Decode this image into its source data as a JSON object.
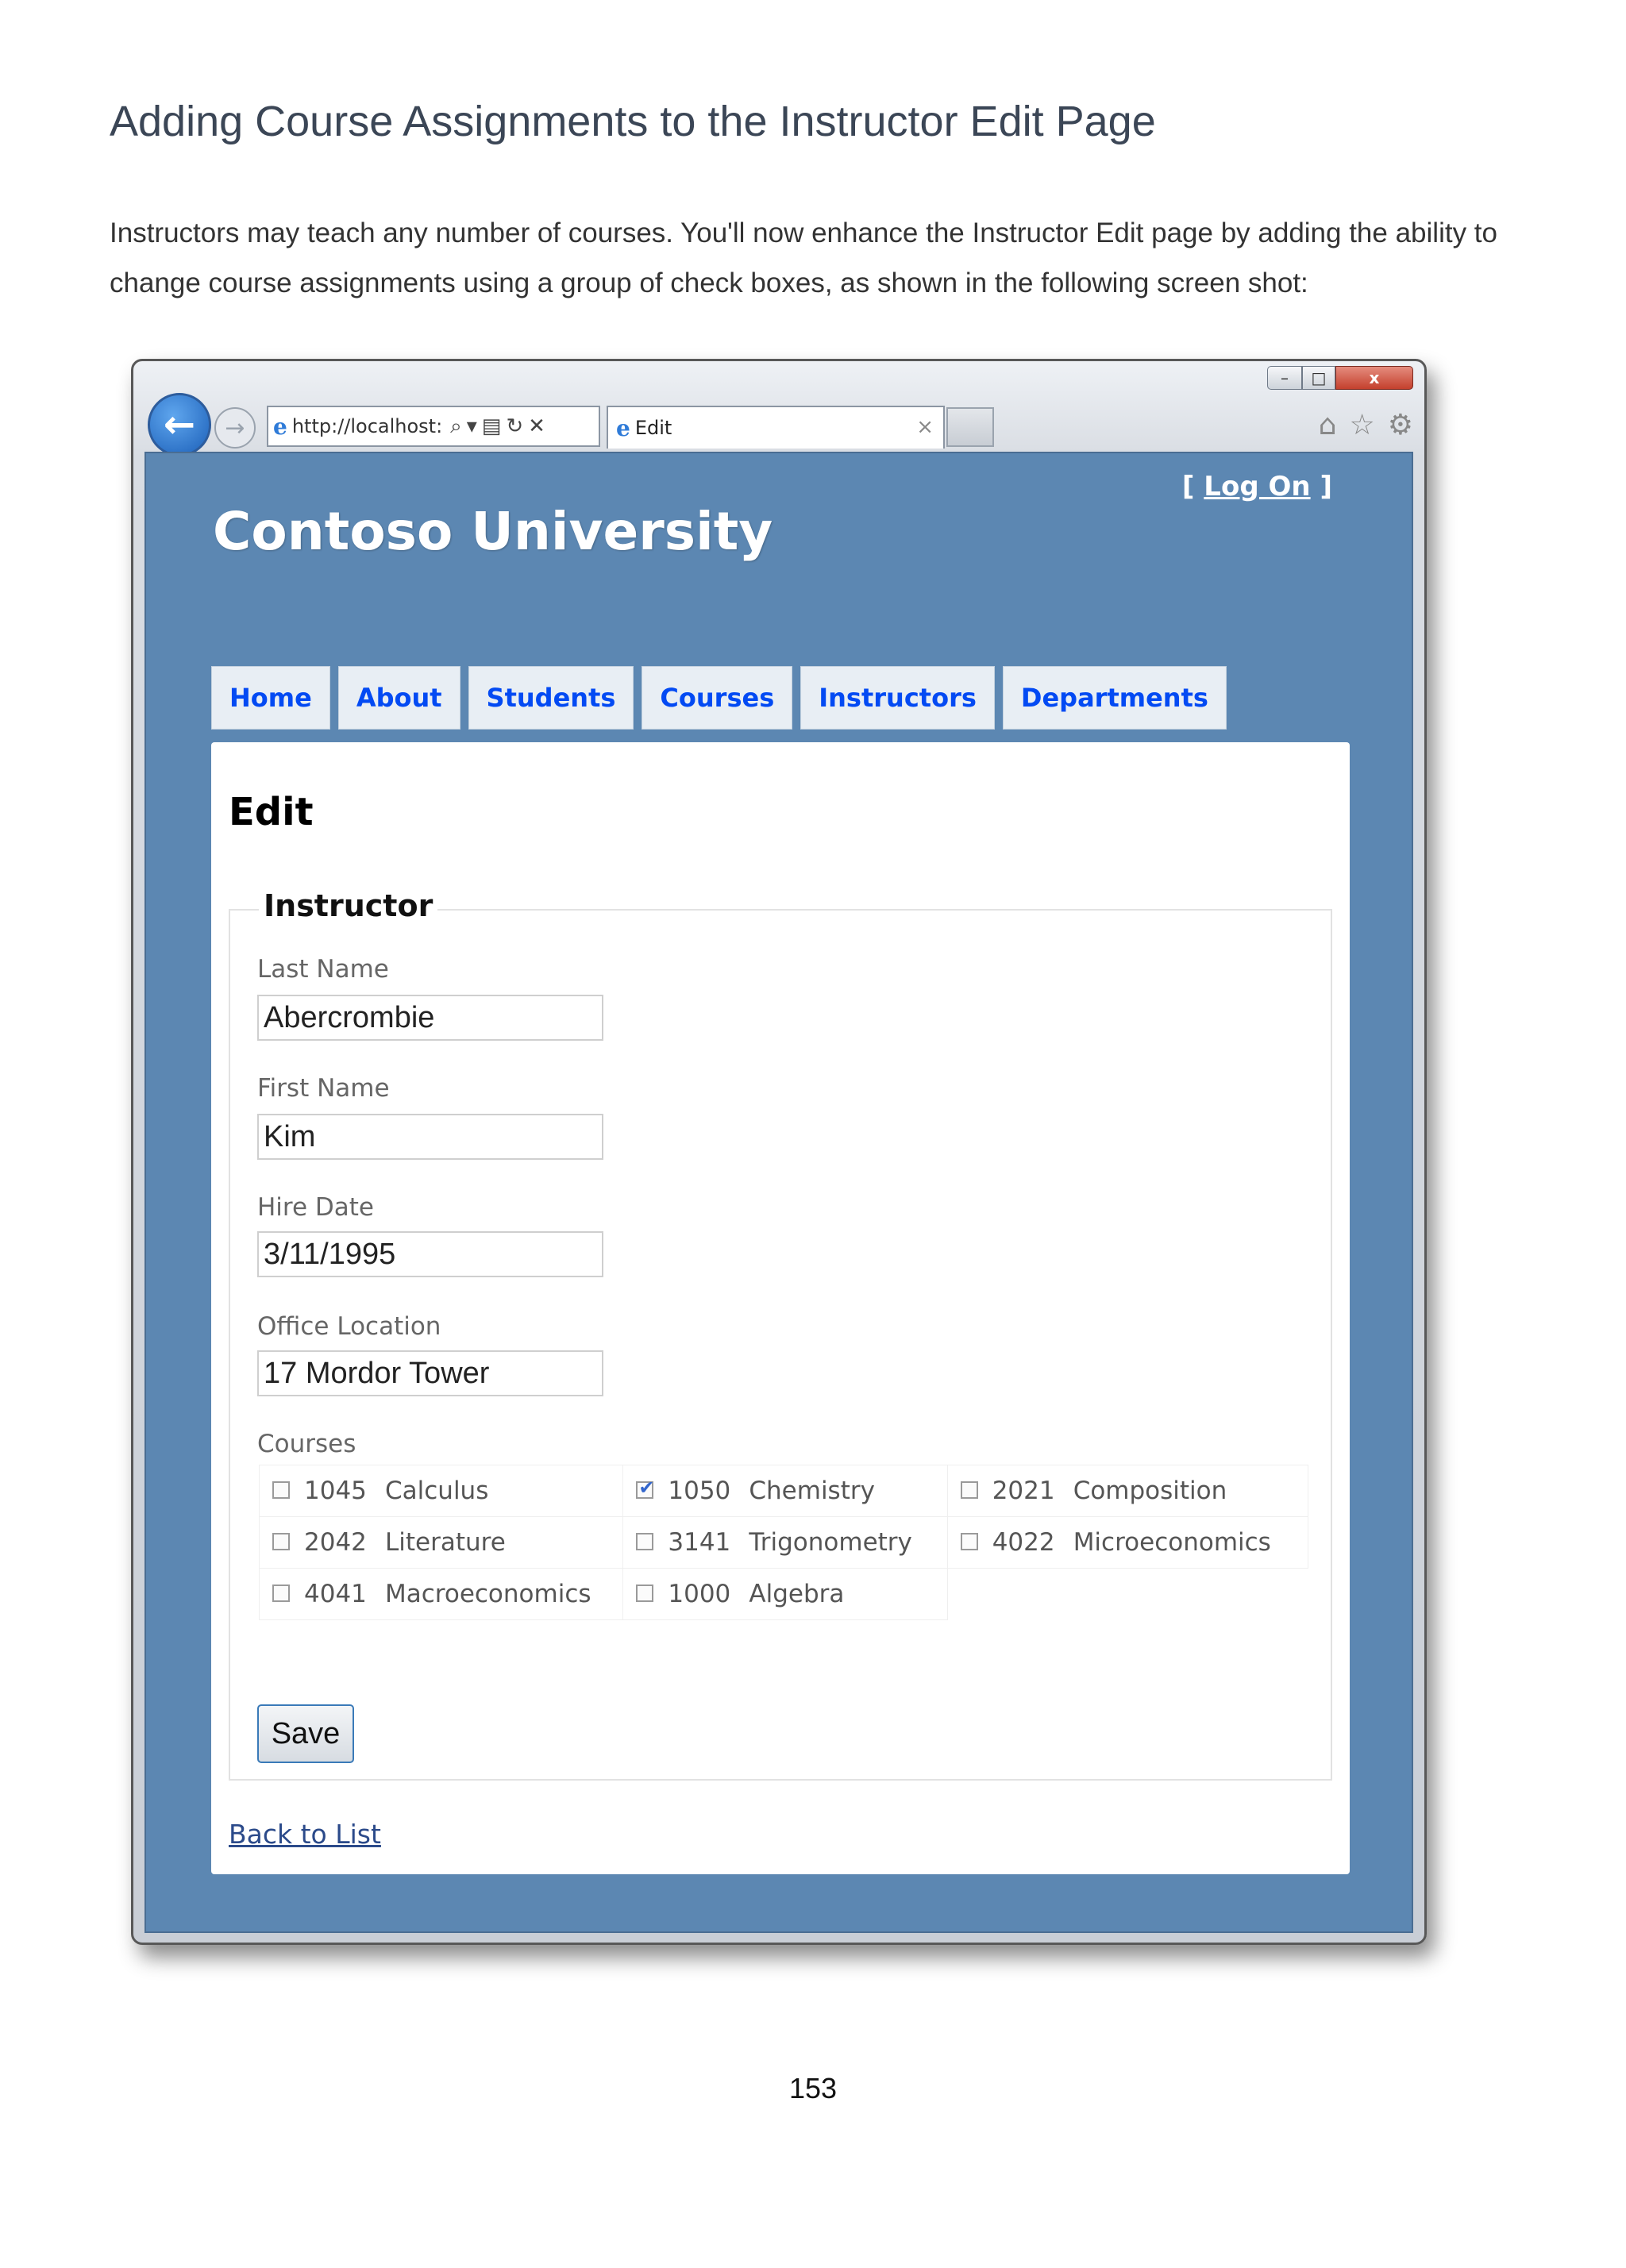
{
  "document": {
    "heading": "Adding Course Assignments to the Instructor Edit Page",
    "paragraph": "Instructors may teach any number of courses. You'll now enhance the Instructor Edit page by adding the ability to change course assignments using a group of check boxes, as shown in the following screen shot:",
    "page_number": "153"
  },
  "browser": {
    "address": "http://localhost:",
    "tab_title": "Edit",
    "window_controls": {
      "minimize": "–",
      "maximize": "□",
      "close": "x"
    }
  },
  "site": {
    "title": "Contoso University",
    "login_prefix": "[ ",
    "login_link": "Log On",
    "login_suffix": " ]",
    "menu": [
      "Home",
      "About",
      "Students",
      "Courses",
      "Instructors",
      "Departments"
    ]
  },
  "edit_form": {
    "heading": "Edit",
    "legend": "Instructor",
    "fields": {
      "last_name": {
        "label": "Last Name",
        "value": "Abercrombie"
      },
      "first_name": {
        "label": "First Name",
        "value": "Kim"
      },
      "hire_date": {
        "label": "Hire Date",
        "value": "3/11/1995"
      },
      "office_location": {
        "label": "Office Location",
        "value": "17 Mordor Tower"
      }
    },
    "courses_label": "Courses",
    "courses": [
      [
        {
          "id": "1045",
          "name": "Calculus",
          "checked": false
        },
        {
          "id": "1050",
          "name": "Chemistry",
          "checked": true
        },
        {
          "id": "2021",
          "name": "Composition",
          "checked": false
        }
      ],
      [
        {
          "id": "2042",
          "name": "Literature",
          "checked": false
        },
        {
          "id": "3141",
          "name": "Trigonometry",
          "checked": false
        },
        {
          "id": "4022",
          "name": "Microeconomics",
          "checked": false
        }
      ],
      [
        {
          "id": "4041",
          "name": "Macroeconomics",
          "checked": false
        },
        {
          "id": "1000",
          "name": "Algebra",
          "checked": false
        }
      ]
    ],
    "save_label": "Save",
    "back_link": "Back to List"
  },
  "colors": {
    "page_background": "#5c87b2",
    "menu_link": "#034af3",
    "checkbox_check": "#3366cc"
  }
}
